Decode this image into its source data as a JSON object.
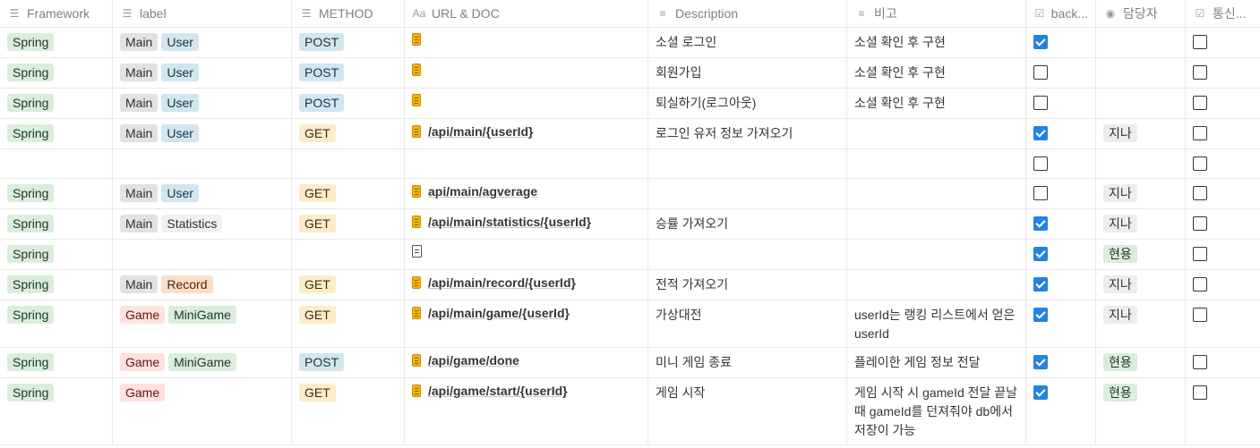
{
  "columns": [
    {
      "icon": "list-icon",
      "label": "Framework"
    },
    {
      "icon": "list-icon",
      "label": "label"
    },
    {
      "icon": "list-icon",
      "label": "METHOD"
    },
    {
      "icon": "title-icon",
      "label": "URL & DOC",
      "icon_text": "Aa"
    },
    {
      "icon": "text-icon",
      "label": "Description"
    },
    {
      "icon": "text-icon",
      "label": "비고"
    },
    {
      "icon": "checkbox-icon",
      "label": "back..."
    },
    {
      "icon": "person-icon",
      "label": "담당자"
    },
    {
      "icon": "checkbox-icon",
      "label": "통신..."
    }
  ],
  "rows": [
    {
      "framework": "Spring",
      "labels": [
        "Main",
        "User"
      ],
      "method": "POST",
      "url": "",
      "icon": "page",
      "desc": "소셜 로그인",
      "note": "소셜 확인 후 구현",
      "back": true,
      "owner": "",
      "comm": false
    },
    {
      "framework": "Spring",
      "labels": [
        "Main",
        "User"
      ],
      "method": "POST",
      "url": "",
      "icon": "page",
      "desc": "회원가입",
      "note": "소셜 확인 후 구현",
      "back": false,
      "owner": "",
      "comm": false
    },
    {
      "framework": "Spring",
      "labels": [
        "Main",
        "User"
      ],
      "method": "POST",
      "url": "",
      "icon": "page",
      "desc": "퇴실하기(로그아웃)",
      "note": "소셜 확인 후 구현",
      "back": false,
      "owner": "",
      "comm": false
    },
    {
      "framework": "Spring",
      "labels": [
        "Main",
        "User"
      ],
      "method": "GET",
      "url": "/api/main/{userId}",
      "icon": "page",
      "desc": "로그인 유저 정보 가져오기",
      "note": "",
      "back": true,
      "owner": "지나",
      "comm": false
    },
    {
      "framework": "",
      "labels": [],
      "method": "",
      "url": "",
      "icon": "",
      "desc": "",
      "note": "",
      "back": false,
      "owner": "",
      "comm": false
    },
    {
      "framework": "Spring",
      "labels": [
        "Main",
        "User"
      ],
      "method": "GET",
      "url": "api/main/agverage",
      "icon": "page",
      "desc": "",
      "note": "",
      "back": false,
      "owner": "지나",
      "comm": false
    },
    {
      "framework": "Spring",
      "labels": [
        "Main",
        "Statistics"
      ],
      "method": "GET",
      "url": "/api/main/statistics/{userId}",
      "icon": "page",
      "desc": "승률 가져오기",
      "note": "",
      "back": true,
      "owner": "지나",
      "comm": false
    },
    {
      "framework": "Spring",
      "labels": [],
      "method": "",
      "url": "",
      "icon": "doc",
      "desc": "",
      "note": "",
      "back": true,
      "owner": "현용",
      "comm": false
    },
    {
      "framework": "Spring",
      "labels": [
        "Main",
        "Record"
      ],
      "method": "GET",
      "url": "/api/main/record/{userId}",
      "icon": "page",
      "desc": "전적 가져오기",
      "note": "",
      "back": true,
      "owner": "지나",
      "comm": false
    },
    {
      "framework": "Spring",
      "labels": [
        "Game",
        "MiniGame"
      ],
      "method": "GET",
      "url": "/api/main/game/{userId}",
      "icon": "page",
      "desc": "가상대전",
      "note": "userId는 랭킹 리스트에서 얻은 userId",
      "back": true,
      "owner": "지나",
      "comm": false
    },
    {
      "framework": "Spring",
      "labels": [
        "Game",
        "MiniGame"
      ],
      "method": "POST",
      "url": "/api/game/done",
      "icon": "page",
      "desc": "미니 게임 종료",
      "note": "플레이한 게임 정보 전달",
      "back": true,
      "owner": "현용",
      "comm": false
    },
    {
      "framework": "Spring",
      "labels": [
        "Game"
      ],
      "method": "GET",
      "url": "/api/game/start/{userId}",
      "icon": "page",
      "desc": "게임 시작",
      "note": "게임 시작 시 gameId 전달 끝날 때 gameId를 던져줘야 db에서 저장이 가능",
      "back": true,
      "owner": "현용",
      "comm": false
    }
  ],
  "tag_colors": {
    "Spring": "green",
    "Main": "gray",
    "User": "blue",
    "Statistics": "lightgray",
    "Record": "orange",
    "Game": "red",
    "MiniGame": "green",
    "POST": "blue",
    "GET": "yellow",
    "지나": "graytag",
    "현용": "green"
  }
}
